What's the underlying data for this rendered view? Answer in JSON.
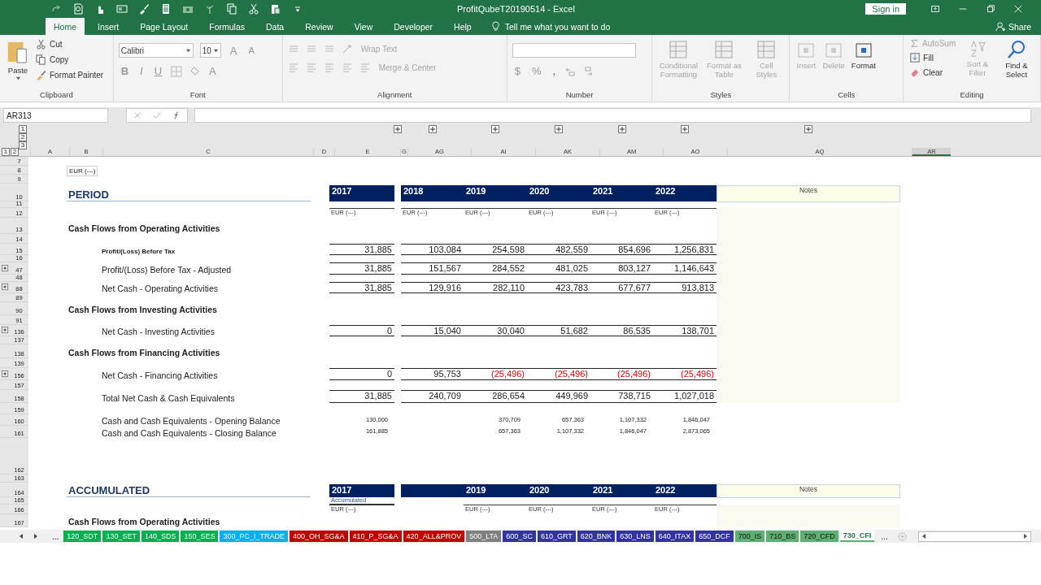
{
  "window": {
    "title": "ProfitQubeT20190514  -  Excel",
    "sign_in": "Sign in",
    "share": "Share"
  },
  "tabs": [
    {
      "label": "Home",
      "selected": true
    },
    {
      "label": "Insert",
      "selected": false
    },
    {
      "label": "Page Layout",
      "selected": false
    },
    {
      "label": "Formulas",
      "selected": false
    },
    {
      "label": "Data",
      "selected": false
    },
    {
      "label": "Review",
      "selected": false
    },
    {
      "label": "View",
      "selected": false
    },
    {
      "label": "Developer",
      "selected": false
    },
    {
      "label": "Help",
      "selected": false
    }
  ],
  "tell_me": "Tell me what you want to do",
  "ribbon": {
    "clipboard": {
      "label": "Clipboard",
      "paste": "Paste",
      "cut": "Cut",
      "copy": "Copy",
      "format_painter": "Format Painter"
    },
    "font": {
      "label": "Font",
      "font_name": "Calibri",
      "font_size": "10",
      "grow": "A",
      "shrink": "A",
      "bold": "B",
      "italic": "I",
      "underline": "U",
      "font_color": "A"
    },
    "alignment": {
      "label": "Alignment",
      "wrap_text": "Wrap Text",
      "merge_center": "Merge & Center"
    },
    "number": {
      "label": "Number",
      "currency": "$",
      "percent": "%",
      "comma": ","
    },
    "styles": {
      "label": "Styles",
      "buttons": [
        {
          "label": "Conditional Formatting",
          "disabled": true
        },
        {
          "label": "Format as Table",
          "disabled": true
        },
        {
          "label": "Cell Styles",
          "disabled": true
        }
      ]
    },
    "cells": {
      "label": "Cells",
      "buttons": [
        {
          "label": "Insert",
          "disabled": true
        },
        {
          "label": "Delete",
          "disabled": true
        },
        {
          "label": "Format",
          "disabled": false
        }
      ]
    },
    "editing": {
      "label": "Editing",
      "autosum": {
        "label": "AutoSum",
        "disabled": true
      },
      "fill": {
        "label": "Fill",
        "disabled": false
      },
      "clear": {
        "label": "Clear",
        "disabled": false
      },
      "sort": {
        "label": "Sort & Filter",
        "disabled": true
      },
      "find": {
        "label": "Find & Select",
        "disabled": false
      }
    }
  },
  "name_box": "AR313",
  "outline_levels_rows": [
    "1",
    "2",
    "3"
  ],
  "outline_levels_cols": [
    "1",
    "2"
  ],
  "columns": [
    "A",
    "B",
    "C",
    "D",
    "E",
    "G",
    "AG",
    "AI",
    "AK",
    "AM",
    "AO",
    "AQ",
    "AR"
  ],
  "rows": [
    {
      "n": "7",
      "kind": "blank"
    },
    {
      "n": "8",
      "kind": "unit_box",
      "label": "EUR (---)"
    },
    {
      "n": "9",
      "kind": "blank"
    },
    {
      "n": "10",
      "kind": "year_header",
      "label": "PERIOD",
      "first_year": "2017",
      "years": [
        "2018",
        "2019",
        "2020",
        "2021",
        "2022"
      ],
      "notes": "Notes"
    },
    {
      "n": "11",
      "kind": "blank"
    },
    {
      "n": "12",
      "kind": "units",
      "first_unit": "EUR (---)",
      "units": [
        "EUR (---)",
        "EUR (---)",
        "EUR (---)",
        "EUR (---)",
        "EUR (---)"
      ],
      "shaded": true
    },
    {
      "n": "13",
      "kind": "section",
      "label": "Cash Flows from Operating Activities",
      "shaded": true
    },
    {
      "n": "14",
      "kind": "blank",
      "shaded": true
    },
    {
      "n": "15",
      "kind": "value",
      "label": "Profit/(Loss) Before Tax",
      "bold": true,
      "expandable": false,
      "shaded": true,
      "cells": [
        {
          "text": "31,885",
          "negative": false
        },
        {
          "text": "103,084",
          "negative": false
        },
        {
          "text": "254,598",
          "negative": false
        },
        {
          "text": "482,559",
          "negative": false
        },
        {
          "text": "854,696",
          "negative": false
        },
        {
          "text": "1,256,831",
          "negative": false
        }
      ]
    },
    {
      "n": "16",
      "kind": "blank",
      "shaded": true
    },
    {
      "n": "47",
      "kind": "value",
      "label": "Profit/(Loss) Before Tax - Adjusted",
      "bold": false,
      "expandable": true,
      "shaded": true,
      "cells": [
        {
          "text": "31,885",
          "negative": false
        },
        {
          "text": "151,567",
          "negative": false
        },
        {
          "text": "284,552",
          "negative": false
        },
        {
          "text": "481,025",
          "negative": false
        },
        {
          "text": "803,127",
          "negative": false
        },
        {
          "text": "1,146,643",
          "negative": false
        }
      ]
    },
    {
      "n": "48",
      "kind": "blank",
      "shaded": true
    },
    {
      "n": "88",
      "kind": "value",
      "label": "Net Cash - Operating Activities",
      "bold": false,
      "expandable": true,
      "shaded": true,
      "cells": [
        {
          "text": "31,885",
          "negative": false
        },
        {
          "text": "129,916",
          "negative": false
        },
        {
          "text": "282,110",
          "negative": false
        },
        {
          "text": "423,783",
          "negative": false
        },
        {
          "text": "677,677",
          "negative": false
        },
        {
          "text": "913,813",
          "negative": false
        }
      ]
    },
    {
      "n": "89",
      "kind": "blank",
      "shaded": true
    },
    {
      "n": "90",
      "kind": "section",
      "label": "Cash Flows from Investing Activities",
      "shaded": true
    },
    {
      "n": "91",
      "kind": "blank",
      "shaded": true
    },
    {
      "n": "136",
      "kind": "value",
      "label": "Net Cash - Investing Activities",
      "bold": false,
      "expandable": true,
      "shaded": true,
      "cells": [
        {
          "text": "0",
          "negative": false
        },
        {
          "text": "15,040",
          "negative": false
        },
        {
          "text": "30,040",
          "negative": false
        },
        {
          "text": "51,682",
          "negative": false
        },
        {
          "text": "86,535",
          "negative": false
        },
        {
          "text": "138,701",
          "negative": false
        }
      ]
    },
    {
      "n": "137",
      "kind": "blank",
      "shaded": true
    },
    {
      "n": "138",
      "kind": "section",
      "label": "Cash Flows from Financing Activities",
      "shaded": true
    },
    {
      "n": "139",
      "kind": "blank",
      "shaded": true
    },
    {
      "n": "156",
      "kind": "value",
      "label": "Net Cash - Financing Activities",
      "bold": false,
      "expandable": true,
      "shaded": true,
      "cells": [
        {
          "text": "0",
          "negative": false
        },
        {
          "text": "95,753",
          "negative": false
        },
        {
          "text": "(25,496)",
          "negative": true
        },
        {
          "text": "(25,496)",
          "negative": true
        },
        {
          "text": "(25,496)",
          "negative": true
        },
        {
          "text": "(25,496)",
          "negative": true
        }
      ]
    },
    {
      "n": "157",
      "kind": "blank",
      "shaded": true
    },
    {
      "n": "158",
      "kind": "value",
      "label": "Total Net Cash & Cash Equivalents",
      "bold": false,
      "expandable": false,
      "shaded": true,
      "cells": [
        {
          "text": "31,885",
          "negative": false
        },
        {
          "text": "240,709",
          "negative": false
        },
        {
          "text": "286,654",
          "negative": false
        },
        {
          "text": "449,969",
          "negative": false
        },
        {
          "text": "738,715",
          "negative": false
        },
        {
          "text": "1,027,018",
          "negative": false
        }
      ]
    },
    {
      "n": "159",
      "kind": "blank"
    },
    {
      "n": "160",
      "kind": "small",
      "label": "Cash and Cash Equivalents - Opening Balance",
      "first": "130,000",
      "cells": [
        "370,709",
        "657,363",
        "1,107,332",
        "1,846,047"
      ]
    },
    {
      "n": "161",
      "kind": "small",
      "label": "Cash and Cash Equivalents - Closing Balance",
      "first": "161,885",
      "cells": [
        "657,363",
        "1,107,332",
        "1,846,047",
        "2,873,065"
      ]
    },
    {
      "n": "162",
      "kind": "blank"
    },
    {
      "n": "163",
      "kind": "blank"
    },
    {
      "n": "164",
      "kind": "year_header",
      "label": "ACCUMULATED",
      "first_year": "2017",
      "years": [
        "2019",
        "2020",
        "2021",
        "2022"
      ],
      "notes": "Notes"
    },
    {
      "n": "165",
      "kind": "caption",
      "caption": "Accumulated"
    },
    {
      "n": "166",
      "kind": "units",
      "first_unit": "EUR (---)",
      "units": [
        "EUR (---)",
        "EUR (---)",
        "EUR (---)",
        "EUR (---)"
      ],
      "shaded": true
    },
    {
      "n": "167",
      "kind": "section",
      "label": "Cash Flows from Operating Activities",
      "shaded": true
    }
  ],
  "sheet_tabs": [
    {
      "label": "120_SDT",
      "color": "#00b050",
      "selected": false
    },
    {
      "label": "130_SET",
      "color": "#00b050",
      "selected": false
    },
    {
      "label": "140_SDS",
      "color": "#00b050",
      "selected": false
    },
    {
      "label": "150_SES",
      "color": "#00b050",
      "selected": false
    },
    {
      "label": "300_PC_I_TRADE",
      "color": "#00b0f0",
      "selected": false
    },
    {
      "label": "400_OH_SG&A",
      "color": "#c00000",
      "selected": false
    },
    {
      "label": "410_P_SG&A",
      "color": "#c00000",
      "selected": false
    },
    {
      "label": "420_ALL&PROV",
      "color": "#c00000",
      "selected": false
    },
    {
      "label": "500_LTA",
      "color": "#808080",
      "selected": false
    },
    {
      "label": "600_SC",
      "color": "#3333a0",
      "selected": false
    },
    {
      "label": "610_GRT",
      "color": "#3333a0",
      "selected": false
    },
    {
      "label": "620_BNK",
      "color": "#3333a0",
      "selected": false
    },
    {
      "label": "630_LNS",
      "color": "#3333a0",
      "selected": false
    },
    {
      "label": "640_ITAX",
      "color": "#3333a0",
      "selected": false
    },
    {
      "label": "650_DCF",
      "color": "#3333a0",
      "selected": false
    },
    {
      "label": "700_IS",
      "color": "#5fae74",
      "selected": false
    },
    {
      "label": "710_BS",
      "color": "#5fae74",
      "selected": false
    },
    {
      "label": "720_CFD",
      "color": "#5fae74",
      "selected": false
    },
    {
      "label": "730_CFI",
      "color": "#5fae74",
      "selected": true
    }
  ],
  "tab_more": "..."
}
